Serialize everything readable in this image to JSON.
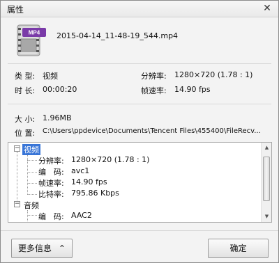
{
  "window": {
    "title": "属性",
    "close_glyph": "✕"
  },
  "file": {
    "name": "2015-04-14_11-48-19_544.mp4",
    "icon_badge": "MP4",
    "icon": "video-file-icon"
  },
  "summary": {
    "type_label": "类 型:",
    "type_value": "视频",
    "duration_label": "时 长:",
    "duration_value": "00:00:20",
    "resolution_label": "分辨率:",
    "resolution_value": "1280×720 (1.78 : 1)",
    "framerate_label": "帧速率:",
    "framerate_value": "14.90 fps"
  },
  "details": {
    "size_label": "大 小:",
    "size_value": "1.96MB",
    "location_label": "位 置:",
    "location_value": "C:\\Users\\ppdevice\\Documents\\Tencent Files\\455400\\FileRecv..."
  },
  "tree": {
    "video": {
      "label": "视频",
      "expanded": true,
      "items": [
        {
          "label": "分辨率:",
          "value": "1280×720 (1.78 : 1)"
        },
        {
          "label": "编　码:",
          "value": "avc1"
        },
        {
          "label": "帧速率:",
          "value": "14.90 fps"
        },
        {
          "label": "比特率:",
          "value": "795.86 Kbps"
        }
      ]
    },
    "audio": {
      "label": "音频",
      "expanded": true,
      "items": [
        {
          "label": "编　码:",
          "value": "AAC2"
        }
      ]
    },
    "toggle_glyph": "−"
  },
  "scrollbar": {
    "position_fraction": 0.15
  },
  "buttons": {
    "more_label": "更多信息",
    "more_glyph": "⌃",
    "ok_label": "确定"
  },
  "colors": {
    "selection": "#3875d7",
    "icon_badge": "#7a3aa8"
  }
}
